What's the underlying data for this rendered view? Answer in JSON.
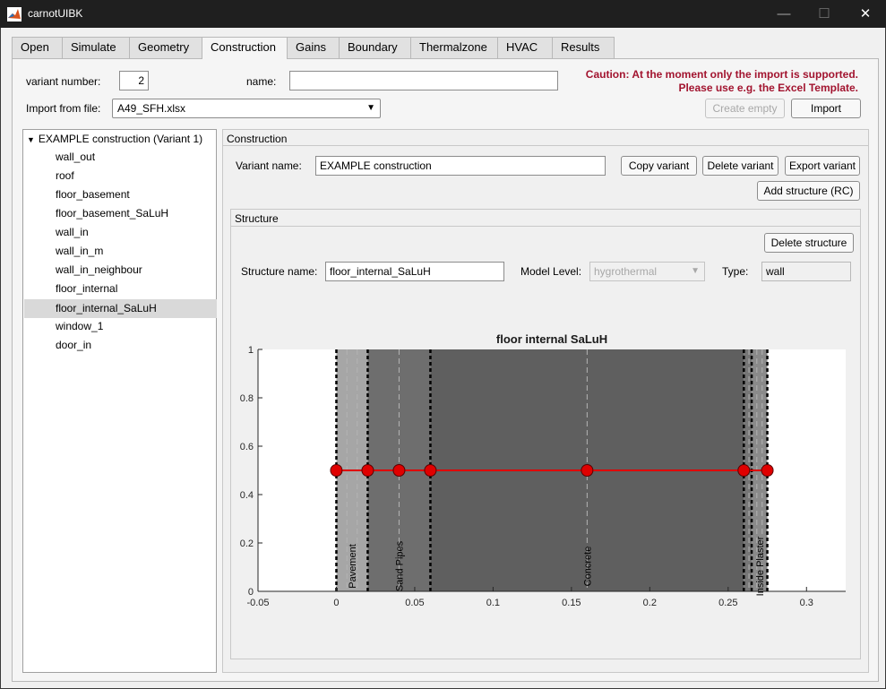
{
  "window": {
    "title": "carnotUIBK",
    "minimize": "—",
    "maximize": "☐",
    "close": "✕"
  },
  "tabs": [
    "Open",
    "Simulate",
    "Geometry",
    "Construction",
    "Gains",
    "Boundary",
    "Thermalzone",
    "HVAC",
    "Results"
  ],
  "header": {
    "variant_number_label": "variant number:",
    "variant_number": "2",
    "name_label": "name:",
    "name_value": "",
    "import_label": "Import from file:",
    "import_file": "A49_SFH.xlsx",
    "caution_line1": "Caution: At the moment only the import is supported.",
    "caution_line2": "Please use e.g. the Excel Template.",
    "create_empty": "Create empty",
    "import_button": "Import"
  },
  "tree": {
    "root": "EXAMPLE construction (Variant 1)",
    "items": [
      "wall_out",
      "roof",
      "floor_basement",
      "floor_basement_SaLuH",
      "wall_in",
      "wall_in_m",
      "wall_in_neighbour",
      "floor_internal",
      "floor_internal_SaLuH",
      "window_1",
      "door_in"
    ],
    "selected": "floor_internal_SaLuH"
  },
  "construction": {
    "panel_title": "Construction",
    "variant_name_label": "Variant name:",
    "variant_name": "EXAMPLE construction",
    "copy_variant": "Copy variant",
    "delete_variant": "Delete variant",
    "export_variant": "Export variant",
    "add_structure": "Add structure (RC)"
  },
  "structure": {
    "panel_title": "Structure",
    "delete_structure": "Delete structure",
    "name_label": "Structure name:",
    "name": "floor_internal_SaLuH",
    "model_level_label": "Model Level:",
    "model_level": "hygrothermal",
    "type_label": "Type:",
    "type": "wall"
  },
  "chart_data": {
    "type": "layer-diagram",
    "title": "floor internal SaLuH",
    "xlim": [
      -0.05,
      0.325
    ],
    "ylim": [
      0,
      1
    ],
    "xticks": [
      -0.05,
      0,
      0.05,
      0.1,
      0.15,
      0.2,
      0.25,
      0.3
    ],
    "xtick_labels": [
      "-0.05",
      "0",
      "0.05",
      "0.1",
      "0.15",
      "0.2",
      "0.25",
      "0.3"
    ],
    "yticks": [
      0,
      0.2,
      0.4,
      0.6,
      0.8,
      1
    ],
    "ytick_labels": [
      "0",
      "0.2",
      "0.4",
      "0.6",
      "0.8",
      "1"
    ],
    "layers": [
      {
        "name": "Pavement",
        "from": 0,
        "to": 0.02,
        "color": "#a6a6a6",
        "label": true
      },
      {
        "name": "Sand Pipes",
        "from": 0.02,
        "to": 0.06,
        "color": "#6e6e6e",
        "label": true
      },
      {
        "name": "Concrete",
        "from": 0.06,
        "to": 0.26,
        "color": "#5f5f5f",
        "label": true
      },
      {
        "name": "",
        "from": 0.26,
        "to": 0.265,
        "color": "#767676",
        "label": false
      },
      {
        "name": "Inside Plaster",
        "from": 0.265,
        "to": 0.275,
        "color": "#8a8a8a",
        "label": true
      }
    ],
    "sublines": [
      0.0067,
      0.0133,
      0.04,
      0.16,
      0.2633,
      0.2683,
      0.2717
    ],
    "nodes_x": [
      0,
      0.02,
      0.04,
      0.06,
      0.16,
      0.26,
      0.275
    ],
    "nodes_y": 0.5,
    "line_color": "#e00000",
    "node_color": "#e00000"
  }
}
